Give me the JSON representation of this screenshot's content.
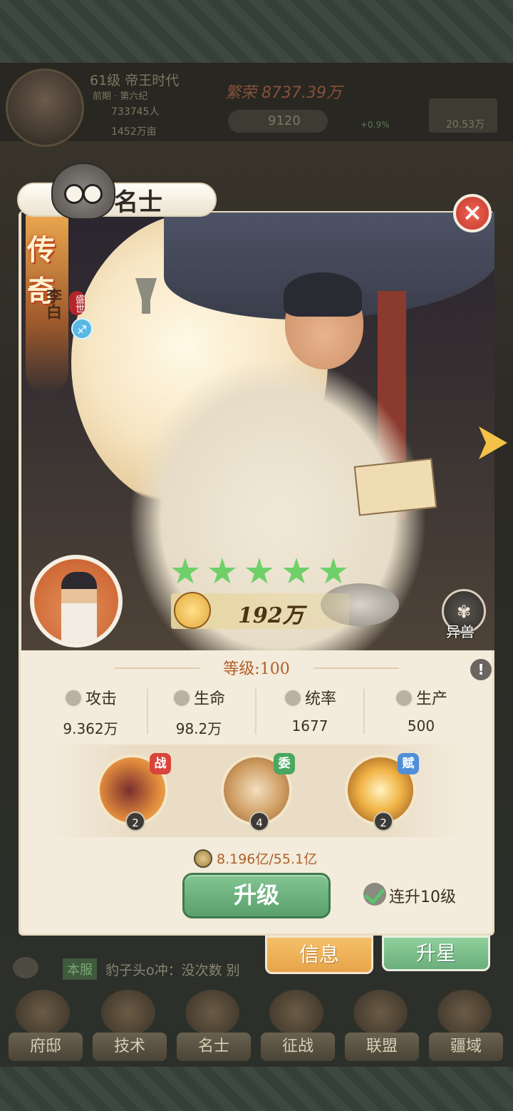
{
  "status_bar": {
    "level_era": "61级 帝王时代",
    "period": "前期 · 第六纪",
    "population": "733745人",
    "land": "1452万亩",
    "prosperity": "繁荣 8737.39万",
    "currency": "9120",
    "growth": "+0.9%",
    "resource": "20.53万"
  },
  "header": {
    "title": "名士"
  },
  "hero": {
    "rarity": "传奇",
    "name": "李白",
    "era_badge": "盛世",
    "zodiac_icon": "sagittarius-icon",
    "stars": 5,
    "power": "192万",
    "beast_label": "异兽"
  },
  "level": "等级:100",
  "stats": [
    {
      "label": "攻击",
      "value": "9.362万",
      "icon": "attack-icon"
    },
    {
      "label": "生命",
      "value": "98.2万",
      "icon": "heart-icon"
    },
    {
      "label": "统率",
      "value": "1677",
      "icon": "command-icon"
    },
    {
      "label": "生产",
      "value": "500",
      "icon": "production-icon"
    }
  ],
  "skills": [
    {
      "tag": "战",
      "level": "2",
      "tag_color": "#d8453a"
    },
    {
      "tag": "委",
      "level": "4",
      "tag_color": "#4aa760"
    },
    {
      "tag": "赋",
      "level": "2",
      "tag_color": "#4f8fd8"
    }
  ],
  "upgrade": {
    "cost": "8.196亿/55.1亿",
    "button": "升级",
    "auto_label": "连升10级",
    "auto_checked": true
  },
  "tabs": {
    "info": "信息",
    "star": "升星"
  },
  "chat": {
    "channel": "本服",
    "message": "豹子头o冲：没次数 别"
  },
  "nav": [
    {
      "label": "府邸"
    },
    {
      "label": "技术"
    },
    {
      "label": "名士"
    },
    {
      "label": "征战"
    },
    {
      "label": "联盟"
    },
    {
      "label": "疆域"
    }
  ]
}
